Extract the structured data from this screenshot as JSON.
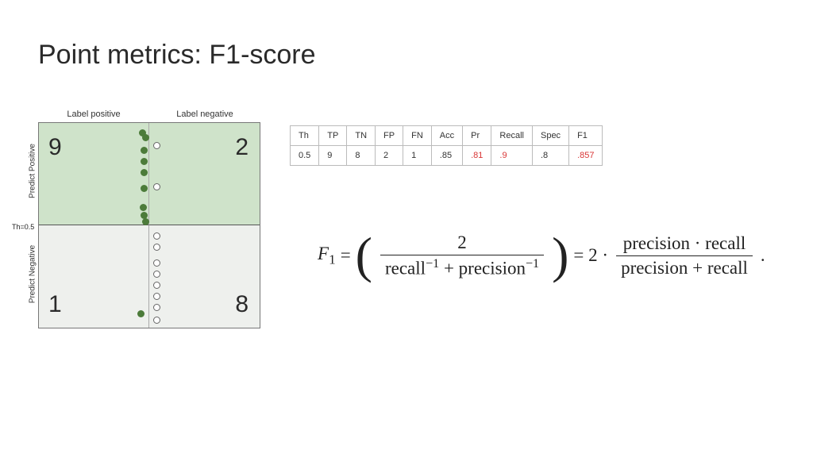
{
  "title": "Point metrics: F1-score",
  "matrix": {
    "top_labels": {
      "pos": "Label positive",
      "neg": "Label negative"
    },
    "side_labels": {
      "ppos": "Predict Positive",
      "pneg": "Predict Negative"
    },
    "threshold_label": "Th=0.5",
    "counts": {
      "tp": "9",
      "fp": "2",
      "fn": "1",
      "tn": "8"
    }
  },
  "table": {
    "headers": [
      "Th",
      "TP",
      "TN",
      "FP",
      "FN",
      "Acc",
      "Pr",
      "Recall",
      "Spec",
      "F1"
    ],
    "rows": [
      {
        "th": "0.5",
        "tp": "9",
        "tn": "8",
        "fp": "2",
        "fn": "1",
        "acc": ".85",
        "pr": ".81",
        "recall": ".9",
        "spec": ".8",
        "f1": ".857"
      }
    ]
  },
  "formula": {
    "lhs_var": "F",
    "lhs_sub": "1",
    "eq1": "=",
    "num1": "2",
    "den1_a": "recall",
    "den1_exp": "−1",
    "den1_plus": " + ",
    "den1_b": "precision",
    "eq2": "= 2 ·",
    "num2": "precision · recall",
    "den2": "precision + recall",
    "dot": "."
  }
}
